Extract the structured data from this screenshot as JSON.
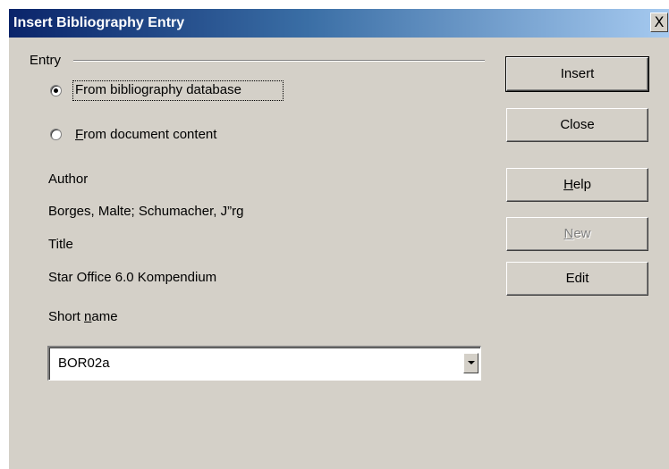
{
  "window": {
    "title": "Insert Bibliography Entry",
    "close_glyph": "X"
  },
  "entry": {
    "group_label": "Entry",
    "radio_database_label": "From bibliography database",
    "radio_database_selected": true,
    "radio_document_prefix": "F",
    "radio_document_rest": "rom document content",
    "radio_document_selected": false
  },
  "fields": {
    "author_label": "Author",
    "author_value": "Borges, Malte; Schumacher, J”rg",
    "title_label": "Title",
    "title_value": "Star Office 6.0 Kompendium",
    "short_name_label_start": "Short ",
    "short_name_label_accel": "n",
    "short_name_label_end": "ame",
    "short_name_value": "BOR02a"
  },
  "buttons": {
    "insert": "Insert",
    "close": "Close",
    "help_accel": "H",
    "help_rest": "elp",
    "new_accel": "N",
    "new_rest": "ew",
    "new_disabled": true,
    "edit": "Edit"
  },
  "icons": {
    "close": "close-icon",
    "dropdown": "chevron-down-icon"
  },
  "colors": {
    "titlebar_start": "#0a246a",
    "titlebar_end": "#a6caf0",
    "dialog_face": "#d4d0c8",
    "disabled_text": "#808080"
  }
}
